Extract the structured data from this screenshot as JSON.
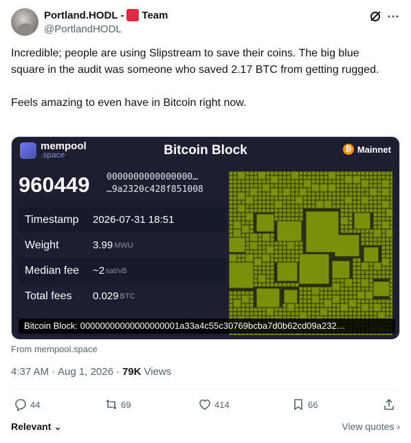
{
  "author": {
    "name": "Portland.HODL -",
    "team_label": "Team",
    "handle": "@PortlandHODL"
  },
  "tweet": {
    "paragraphs": [
      "Incredible; people are using Slipstream to save their coins. The big blue square in the audit was someone who saved 2.17 BTC from getting rugged.",
      "Feels amazing to even have in Bitcoin right now."
    ]
  },
  "card": {
    "brand_name": "mempool",
    "brand_sub": ".space",
    "title": "Bitcoin Block",
    "network": "Mainnet",
    "block_height": "960449",
    "hash_line1": "0000000000000000…",
    "hash_line2": "…9a2320c428f851008",
    "rows": [
      {
        "label": "Timestamp",
        "value": "2026-07-31 18:51",
        "unit": ""
      },
      {
        "label": "Weight",
        "value": "3.99",
        "unit": "MWU"
      },
      {
        "label": "Median fee",
        "value": "~2",
        "unit": "sat/vB"
      },
      {
        "label": "Total fees",
        "value": "0.029",
        "unit": "BTC"
      }
    ],
    "caption": "Bitcoin Block: 00000000000000000001a33a4c55c30769bcba7d0b62cd09a232…",
    "colors": {
      "background": "#1d1f31",
      "treemap": "#7a8f0a",
      "treemap_grid": "#2b2f12"
    }
  },
  "source": "From mempool.space",
  "meta": {
    "time": "4:37 AM",
    "date": "Aug 1, 2026",
    "views_count": "79K",
    "views_label": "Views"
  },
  "actions": {
    "replies": "44",
    "reposts": "69",
    "likes": "414",
    "bookmarks": "66"
  },
  "footer": {
    "relevant": "Relevant",
    "view_quotes": "View quotes"
  }
}
